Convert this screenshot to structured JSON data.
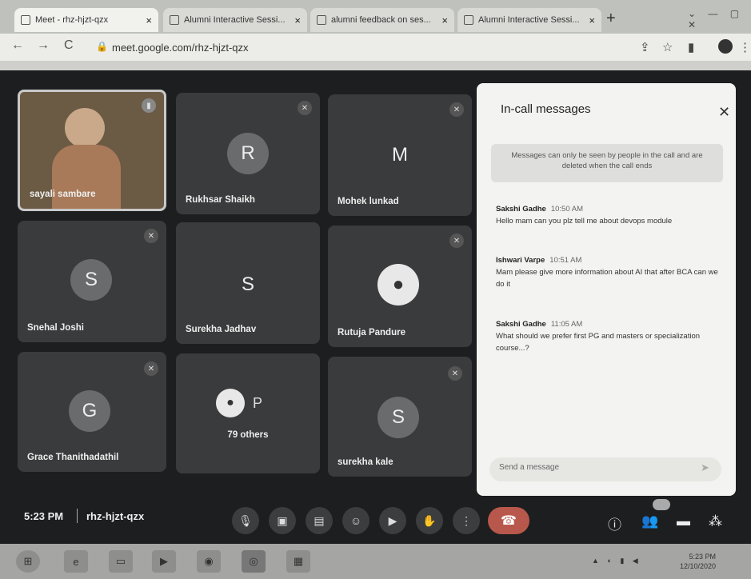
{
  "tabs": [
    {
      "title": "Meet - rhz-hjzt-qzx",
      "active": true
    },
    {
      "title": "Alumni Interactive Sessi...",
      "active": false
    },
    {
      "title": "alumni feedback on ses...",
      "active": false
    },
    {
      "title": "Alumni Interactive Sessi...",
      "active": false
    }
  ],
  "toolbar": {
    "url": "meet.google.com/rhz-hjzt-qzx",
    "new_tab": "+",
    "back": "←",
    "forward": "→",
    "reload": "C"
  },
  "participants": [
    {
      "name": "sayali sambare",
      "initial": "",
      "color": "#6b5a44",
      "video": true
    },
    {
      "name": "Rukhsar Shaikh",
      "initial": "R",
      "color": "#6a6b6c"
    },
    {
      "name": "Mohek lunkad",
      "initial": "M",
      "color": "#3a3b3c"
    },
    {
      "name": "Snehal Joshi",
      "initial": "S",
      "color": "#6a6b6c"
    },
    {
      "name": "Surekha Jadhav",
      "initial": "S",
      "color": "#3a3b3c"
    },
    {
      "name": "Rutuja Pandure",
      "initial": "",
      "color": "#ddd"
    },
    {
      "name": "Grace Thanithadathil",
      "initial": "G",
      "color": "#6a6b6c"
    },
    {
      "name": "79 others",
      "initial": "P",
      "color": "#3a3b3c"
    },
    {
      "name": "surekha kale",
      "initial": "S",
      "color": "#6a6b6c"
    }
  ],
  "chat": {
    "title": "In-call messages",
    "notice": "Messages can only be seen by people in the call and are deleted when the call ends",
    "messages": [
      {
        "sender": "Sakshi Gadhe",
        "time": "10:50 AM",
        "text": "Hello mam can you plz tell me about devops module"
      },
      {
        "sender": "Ishwari Varpe",
        "time": "10:51 AM",
        "text": "Mam please give more information about AI that after BCA can we do it"
      },
      {
        "sender": "Sakshi Gadhe",
        "time": "11:05 AM",
        "text": "What should we prefer first PG and masters or specialization course...?"
      }
    ],
    "send_placeholder": "Send a message"
  },
  "meeting": {
    "time": "5:23 PM",
    "code": "rhz-hjzt-qzx"
  },
  "taskbar": {
    "clock_time": "5:23 PM",
    "clock_date": "12/10/2020"
  }
}
